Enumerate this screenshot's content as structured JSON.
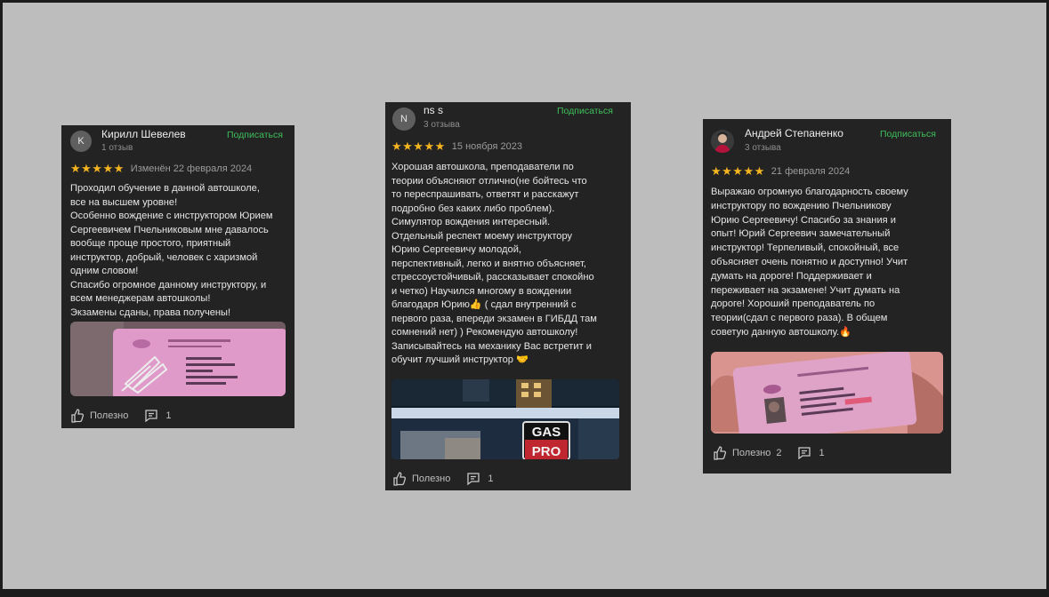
{
  "reviews": [
    {
      "author": "Кирилл Шевелев",
      "avatar_letter": "K",
      "review_count": "1 отзыв",
      "subscribe_label": "Подписаться",
      "stars": "★★★★★",
      "date": "Изменён 22 февраля 2024",
      "text_lines": [
        "Проходил обучение в данной автошколе,",
        "все на высшем уровне!",
        "Особенно вождение с инструктором Юрием",
        "Сергеевичем Пчельниковым мне давалось",
        "вообще проще простого, приятный",
        "инструктор, добрый, человек с харизмой",
        "одним словом!",
        "Спасибо огромное данному инструктору, и",
        "всем менеджерам автошколы!",
        "Экзамены сданы, права получены!"
      ],
      "helpful_label": "Полезно",
      "comments": "1",
      "photo_icon": "driving-licence-photo"
    },
    {
      "author": "ns s",
      "avatar_letter": "N",
      "review_count": "3 отзыва",
      "subscribe_label": "Подписаться",
      "stars": "★★★★★",
      "date": "15 ноября 2023",
      "text_lines": [
        "Хорошая автошкола, преподаватели по",
        "теории объясняют отлично(не бойтесь что",
        "то переспрашивать, ответят и расскажут",
        "подробно без каких либо проблем).",
        "Симулятор вождения интересный.",
        "Отдельный респект моему инструктору",
        "Юрию Сергеевичу молодой,",
        "перспективный, легко и внятно объясняет,",
        "стрессоустойчивый, рассказывает спокойно",
        "и четко) Научился многому в вождении",
        "благодаря Юрию👍 ( сдал внутренний с",
        "первого раза, впереди экзамен в ГИБДД там",
        "сомнений нет) ) Рекомендую автошколу!",
        "Записывайтесь на механику Вас встретит и",
        "обучит лучший инструктор 🤝"
      ],
      "helpful_label": "Полезно",
      "comments": "1",
      "photo_sign_top": "GAS",
      "photo_sign_bottom": "PRO"
    },
    {
      "author": "Андрей Степаненко",
      "review_count": "3 отзыва",
      "subscribe_label": "Подписаться",
      "stars": "★★★★★",
      "date": "21 февраля 2024",
      "text_lines": [
        "Выражаю огромную благодарность своему",
        "инструктору по вождению Пчельникову",
        "Юрию Сергеевичу! Спасибо за знания и",
        "опыт! Юрий Сергеевич замечательный",
        "инструктор! Терпеливый, спокойный, все",
        "объясняет очень понятно и доступно! Учит",
        "думать на дороге!  Поддерживает и",
        "переживает на экзамене! Учит думать на",
        "дороге! Хороший преподаватель по",
        "теории(сдал с первого раза). В общем",
        "советую данную автошколу.🔥"
      ],
      "helpful_label": "Полезно",
      "helpful_count": "2",
      "comments": "1",
      "photo_icon": "driving-licence-photo"
    }
  ],
  "colors": {
    "card_bg": "#232323",
    "subscribe": "#3fbf5b",
    "star": "#f5b520",
    "backdrop": "#bdbdbd"
  },
  "icons": {
    "helpful": "thumbs-up-icon",
    "comment": "comment-icon"
  }
}
